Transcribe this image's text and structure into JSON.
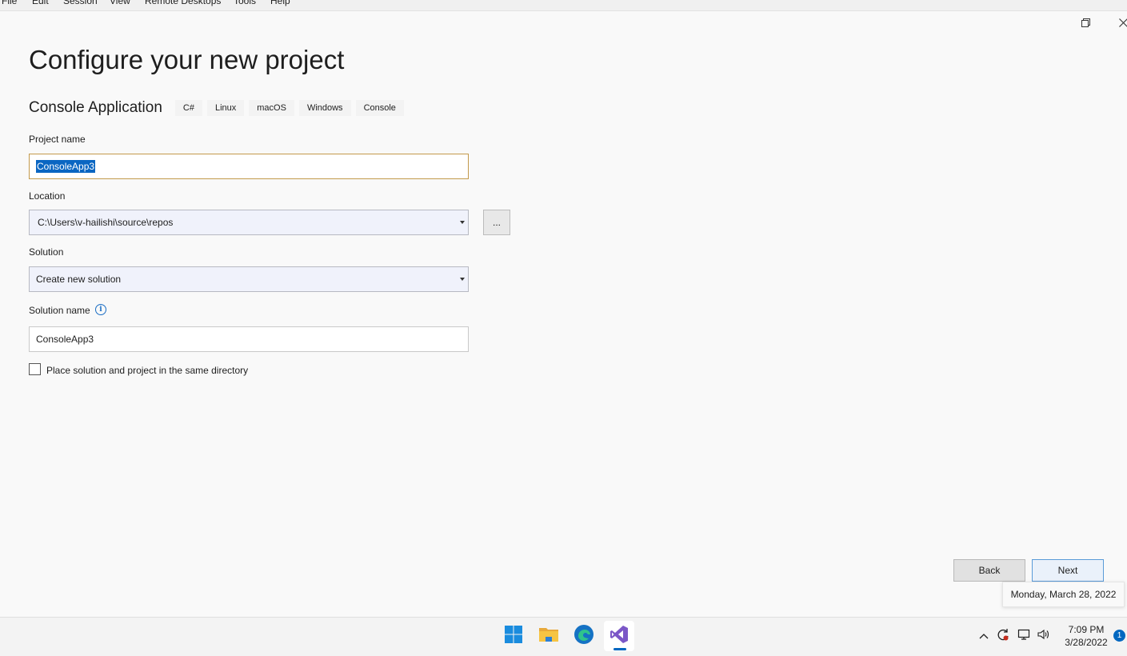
{
  "menu": {
    "items": [
      "File",
      "Edit",
      "Session",
      "View",
      "Remote Desktops",
      "Tools",
      "Help"
    ]
  },
  "window": {
    "restore_icon": "restore-icon",
    "close_icon": "close-icon"
  },
  "page": {
    "title": "Configure your new project",
    "template_name": "Console Application",
    "tags": [
      "C#",
      "Linux",
      "macOS",
      "Windows",
      "Console"
    ]
  },
  "form": {
    "project_name_label": "Project name",
    "project_name_value": "ConsoleApp3",
    "location_label": "Location",
    "location_value": "C:\\Users\\v-hailishi\\source\\repos",
    "browse_label": "...",
    "solution_label": "Solution",
    "solution_value": "Create new solution",
    "solution_name_label": "Solution name",
    "solution_name_value": "ConsoleApp3",
    "info_glyph": "i",
    "same_dir_label": "Place solution and project in the same directory",
    "same_dir_checked": false
  },
  "buttons": {
    "back": "Back",
    "next": "Next"
  },
  "tooltip": {
    "text": "Monday, March 28, 2022"
  },
  "taskbar": {
    "apps": [
      "windows-start-icon",
      "file-explorer-icon",
      "edge-browser-icon",
      "visual-studio-icon"
    ],
    "active_app": "visual-studio-icon",
    "tray": [
      "chevron-up-icon",
      "sync-icon",
      "network-icon",
      "volume-icon"
    ],
    "time": "7:09 PM",
    "date": "3/28/2022",
    "notification_count": "1",
    "accent": "#0067c0"
  },
  "colors": {
    "selection": "#0a66c2",
    "focus_border": "#c39a4b",
    "primary_border": "#5a9bd8",
    "vs_purple": "#7b57c7"
  }
}
